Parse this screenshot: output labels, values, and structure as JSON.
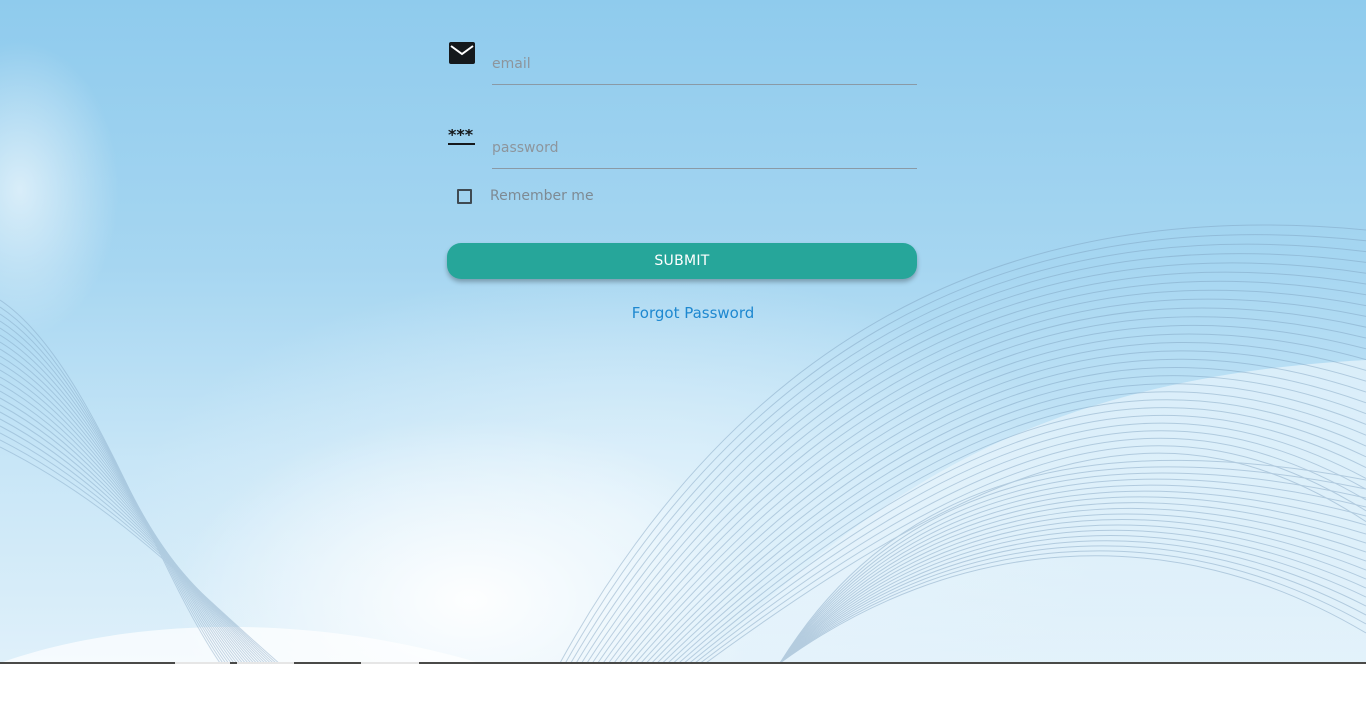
{
  "form": {
    "email_placeholder": "email",
    "email_value": "",
    "password_placeholder": "password",
    "password_value": "",
    "remember_label": "Remember me",
    "remember_checked": false,
    "submit_label": "SUBMIT",
    "forgot_label": "Forgot Password"
  },
  "icons": {
    "email": "envelope-icon",
    "password": "password-dots-icon"
  },
  "colors": {
    "accent": "#26a69a",
    "link": "#1e88d0",
    "background_top": "#8fcbed"
  }
}
